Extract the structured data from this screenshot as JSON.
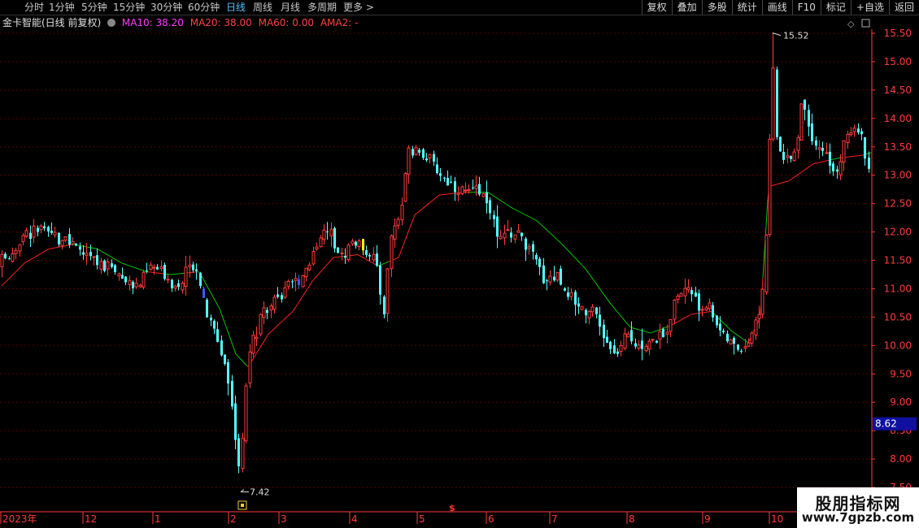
{
  "toolbar": {
    "periods": [
      "分时",
      "1分钟",
      "5分钟",
      "15分钟",
      "30分钟",
      "60分钟",
      "日线",
      "周线",
      "月线",
      "多周期",
      "更多"
    ],
    "active_index": 6,
    "more_arrow": ">",
    "right_buttons": [
      "复权",
      "叠加",
      "多股",
      "统计",
      "画线",
      "F10",
      "+自选",
      "返回"
    ],
    "right_extra": "标记"
  },
  "info": {
    "stock_name": "金卡智能(日线 前复权)",
    "ma10": "MA10: 38.20",
    "ma20": "MA20: 38.00",
    "ma60": "MA60: 0.00",
    "ama2": "AMA2: -"
  },
  "colors": {
    "up": "#ff3b3b",
    "down": "#54ffff",
    "yellow": "#ffff00",
    "blue": "#3f5bff",
    "ma_green": "#00c800",
    "ma_red": "#ff2020",
    "grid": "#5a0000",
    "axis_text": "#ff3b3b"
  },
  "chart_data": {
    "type": "candlestick",
    "y_ticks": [
      "15.50",
      "15.00",
      "14.50",
      "14.00",
      "13.50",
      "13.00",
      "12.50",
      "12.00",
      "11.50",
      "11.00",
      "10.50",
      "10.00",
      "9.50",
      "9.00",
      "8.50",
      "8.00",
      "7.50"
    ],
    "ylim": [
      7.5,
      15.7
    ],
    "x_labels": [
      "2023年",
      "12",
      "1",
      "2",
      "3",
      "4",
      "5",
      "6",
      "7",
      "8",
      "9",
      "10"
    ],
    "high_marker": "15.52",
    "low_marker": "7.42",
    "current_price": "8.62",
    "anchors": [
      [
        0,
        11.45
      ],
      [
        15,
        11.65
      ],
      [
        30,
        11.95
      ],
      [
        48,
        12.05
      ],
      [
        62,
        11.95
      ],
      [
        80,
        11.85
      ],
      [
        100,
        11.65
      ],
      [
        120,
        11.45
      ],
      [
        140,
        11.35
      ],
      [
        158,
        11.05
      ],
      [
        172,
        11.1
      ],
      [
        185,
        11.4
      ],
      [
        200,
        11.3
      ],
      [
        215,
        11.05
      ],
      [
        232,
        11.35
      ],
      [
        240,
        11.5
      ],
      [
        252,
        10.6
      ],
      [
        265,
        10.2
      ],
      [
        278,
        9.6
      ],
      [
        288,
        8.6
      ],
      [
        295,
        7.7
      ],
      [
        305,
        9.9
      ],
      [
        320,
        10.45
      ],
      [
        335,
        10.7
      ],
      [
        350,
        10.95
      ],
      [
        365,
        11.15
      ],
      [
        380,
        11.45
      ],
      [
        392,
        11.95
      ],
      [
        405,
        11.95
      ],
      [
        420,
        11.55
      ],
      [
        432,
        11.85
      ],
      [
        445,
        11.75
      ],
      [
        460,
        11.55
      ],
      [
        472,
        10.6
      ],
      [
        480,
        11.95
      ],
      [
        492,
        12.35
      ],
      [
        502,
        13.35
      ],
      [
        510,
        13.4
      ],
      [
        520,
        13.4
      ],
      [
        530,
        13.25
      ],
      [
        545,
        12.95
      ],
      [
        560,
        12.8
      ],
      [
        575,
        12.7
      ],
      [
        590,
        12.65
      ],
      [
        600,
        12.55
      ],
      [
        612,
        11.85
      ],
      [
        625,
        12.0
      ],
      [
        640,
        11.95
      ],
      [
        652,
        11.65
      ],
      [
        668,
        11.2
      ],
      [
        685,
        11.25
      ],
      [
        700,
        10.9
      ],
      [
        715,
        10.7
      ],
      [
        730,
        10.55
      ],
      [
        745,
        10.05
      ],
      [
        755,
        9.8
      ],
      [
        770,
        10.15
      ],
      [
        785,
        10.05
      ],
      [
        800,
        10.05
      ],
      [
        815,
        10.15
      ],
      [
        825,
        10.55
      ],
      [
        840,
        11.05
      ],
      [
        850,
        10.95
      ],
      [
        860,
        10.65
      ],
      [
        870,
        10.75
      ],
      [
        880,
        10.45
      ],
      [
        890,
        10.15
      ],
      [
        905,
        9.95
      ],
      [
        918,
        10.05
      ],
      [
        930,
        10.45
      ],
      [
        938,
        11.05
      ],
      [
        942,
        12.1
      ],
      [
        946,
        13.6
      ],
      [
        949,
        15.25
      ],
      [
        955,
        13.55
      ],
      [
        965,
        13.2
      ],
      [
        978,
        13.45
      ],
      [
        987,
        14.4
      ],
      [
        996,
        13.75
      ],
      [
        1008,
        13.5
      ],
      [
        1018,
        13.3
      ],
      [
        1025,
        13.0
      ],
      [
        1035,
        13.4
      ],
      [
        1048,
        13.95
      ],
      [
        1058,
        13.75
      ],
      [
        1068,
        13.1
      ],
      [
        1072,
        12.9
      ]
    ],
    "ma_anchors": [
      [
        2,
        11.05
      ],
      [
        30,
        11.45
      ],
      [
        60,
        11.7
      ],
      [
        90,
        11.78
      ],
      [
        120,
        11.7
      ],
      [
        150,
        11.45
      ],
      [
        180,
        11.3
      ],
      [
        210,
        11.25
      ],
      [
        245,
        11.3
      ],
      [
        270,
        10.65
      ],
      [
        290,
        9.85
      ],
      [
        305,
        9.62
      ],
      [
        330,
        10.2
      ],
      [
        360,
        10.6
      ],
      [
        385,
        11.15
      ],
      [
        410,
        11.55
      ],
      [
        440,
        11.6
      ],
      [
        465,
        11.4
      ],
      [
        490,
        11.55
      ],
      [
        510,
        12.3
      ],
      [
        540,
        12.65
      ],
      [
        570,
        12.7
      ],
      [
        600,
        12.7
      ],
      [
        630,
        12.42
      ],
      [
        660,
        12.2
      ],
      [
        690,
        11.8
      ],
      [
        720,
        11.35
      ],
      [
        750,
        10.75
      ],
      [
        775,
        10.32
      ],
      [
        800,
        10.22
      ],
      [
        825,
        10.35
      ],
      [
        850,
        10.55
      ],
      [
        875,
        10.6
      ],
      [
        900,
        10.25
      ],
      [
        920,
        10.05
      ],
      [
        935,
        10.5
      ],
      [
        945,
        12.8
      ],
      [
        970,
        12.9
      ],
      [
        1000,
        13.2
      ],
      [
        1030,
        13.3
      ],
      [
        1060,
        13.35
      ],
      [
        1072,
        13.4
      ]
    ]
  }
}
